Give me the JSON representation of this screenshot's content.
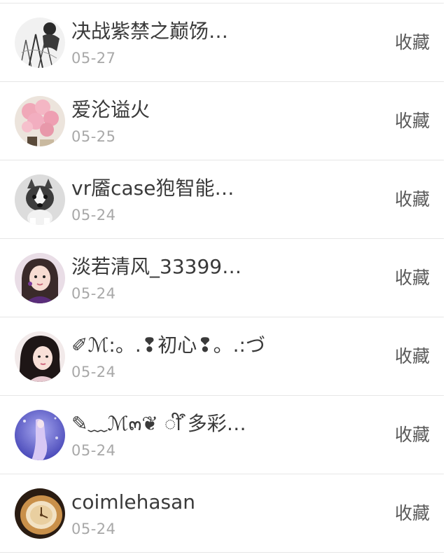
{
  "rows": [
    {
      "name": "决战紫禁之巅饧…",
      "date": "05-27",
      "action": "收藏",
      "avatar": "sketch-portrait-avatar"
    },
    {
      "name": "爱沦谥火",
      "date": "05-25",
      "action": "收藏",
      "avatar": "pink-balloons-avatar"
    },
    {
      "name": "vr靥case狍智能…",
      "date": "05-24",
      "action": "收藏",
      "avatar": "husky-dog-avatar"
    },
    {
      "name": "淡若清风_33399…",
      "date": "05-24",
      "action": "收藏",
      "avatar": "girl-purple-avatar"
    },
    {
      "name": "✐ℳ:。.❢初心❢。.:づ",
      "date": "05-24",
      "action": "收藏",
      "avatar": "girl-dark-hair-avatar"
    },
    {
      "name": "✎﹏ℳ๓❦ ी ͒多彩…",
      "date": "05-24",
      "action": "收藏",
      "avatar": "blue-fantasy-avatar"
    },
    {
      "name": "coimlehasan",
      "date": "05-24",
      "action": "收藏",
      "avatar": "golden-watch-avatar"
    }
  ]
}
